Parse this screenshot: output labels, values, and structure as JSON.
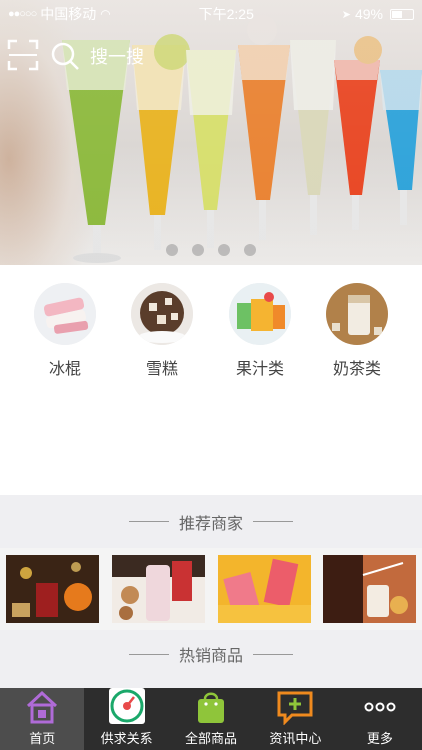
{
  "status_bar": {
    "carrier": "中国移动",
    "time": "下午2:25",
    "battery": "49%",
    "battery_level": 0.49
  },
  "search": {
    "placeholder": "搜一搜"
  },
  "banner": {
    "slide_count": 4,
    "active_slide": 0
  },
  "categories": [
    {
      "label": "冰棍",
      "icon": "popsicle-image"
    },
    {
      "label": "雪糕",
      "icon": "ice-cream-image"
    },
    {
      "label": "果汁类",
      "icon": "juice-image"
    },
    {
      "label": "奶茶类",
      "icon": "milk-tea-image"
    }
  ],
  "sections": {
    "recommended_merchants": "推荐商家",
    "hot_products": "热销商品"
  },
  "tabbar": {
    "items": [
      {
        "label": "首页",
        "icon": "home-icon",
        "active": true
      },
      {
        "label": "供求关系",
        "icon": "supply-demand-icon",
        "active": false
      },
      {
        "label": "全部商品",
        "icon": "shopping-bag-icon",
        "active": false
      },
      {
        "label": "资讯中心",
        "icon": "news-chat-icon",
        "active": false
      },
      {
        "label": "更多",
        "icon": "more-dots-icon",
        "active": false
      }
    ]
  },
  "colors": {
    "tabbar_bg": "#2d2d2d",
    "section_bg": "#efeff2",
    "home_icon": "#b06bd8",
    "bag_icon": "#8fc53a",
    "news_icon": "#f08a1e",
    "supply_icon": "#1aa86a"
  }
}
